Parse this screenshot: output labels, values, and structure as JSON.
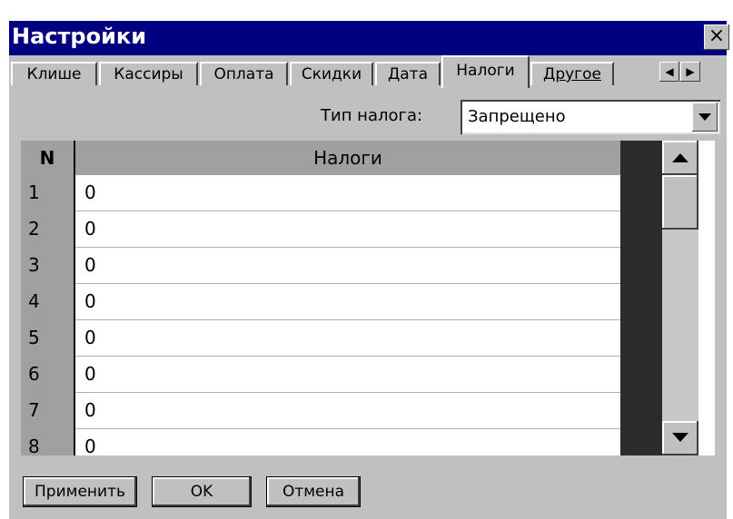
{
  "window": {
    "title": "Настройки",
    "close_glyph": "×"
  },
  "tabs": [
    {
      "label": "Клише"
    },
    {
      "label": "Кассиры"
    },
    {
      "label": "Оплата"
    },
    {
      "label": "Скидки"
    },
    {
      "label": "Дата"
    },
    {
      "label": "Налоги",
      "active": true
    },
    {
      "label": "Другое"
    }
  ],
  "tab_scroll": {
    "left": "◀",
    "right": "▶"
  },
  "tax_type": {
    "label": "Тип налога:",
    "value": "Запрещено"
  },
  "grid": {
    "headers": {
      "n": "N",
      "taxes": "Налоги"
    },
    "rows": [
      {
        "n": "1",
        "value": "0"
      },
      {
        "n": "2",
        "value": "0"
      },
      {
        "n": "3",
        "value": "0"
      },
      {
        "n": "4",
        "value": "0"
      },
      {
        "n": "5",
        "value": "0"
      },
      {
        "n": "6",
        "value": "0"
      },
      {
        "n": "7",
        "value": "0"
      },
      {
        "n": "8",
        "value": "0"
      }
    ]
  },
  "buttons": {
    "apply": "Применить",
    "ok": "OK",
    "cancel": "Отмена"
  },
  "colors": {
    "titlebar": "#000080",
    "face": "#c0c0c0",
    "header": "#a0a0a0"
  }
}
